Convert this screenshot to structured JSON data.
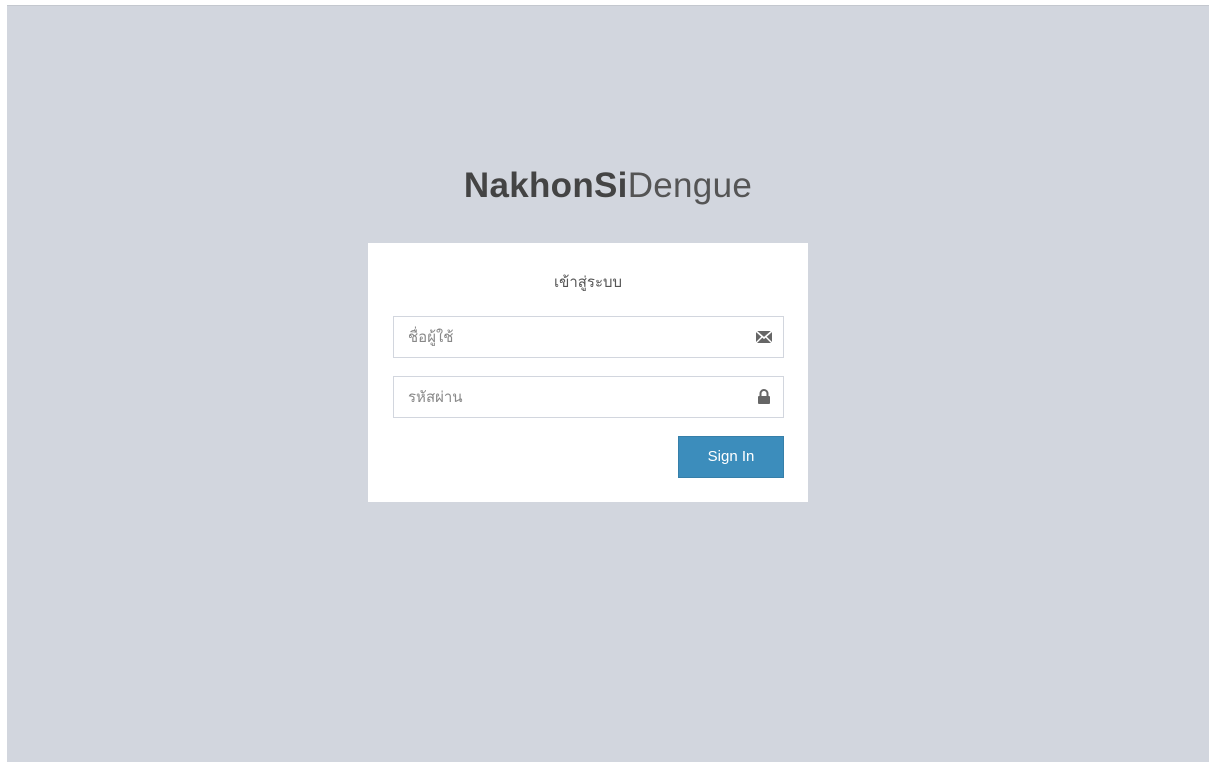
{
  "logo": {
    "bold_text": "NakhonSi",
    "light_text": "Dengue"
  },
  "login_box": {
    "message": "เข้าสู่ระบบ",
    "username": {
      "placeholder": "ชื่อผู้ใช้",
      "value": "",
      "icon": "envelope-icon"
    },
    "password": {
      "placeholder": "รหัสผ่าน",
      "value": "",
      "icon": "lock-icon"
    },
    "sign_in_label": "Sign In"
  },
  "colors": {
    "background": "#d2d6de",
    "button": "#3c8dbc",
    "logo_text": "#444444"
  }
}
